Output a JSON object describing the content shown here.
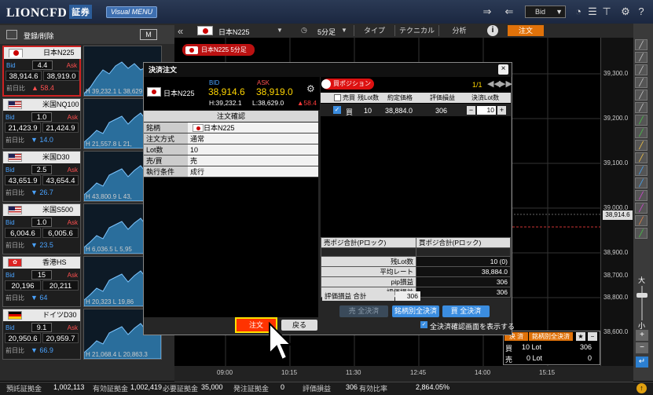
{
  "header": {
    "logo": "LIONCFD",
    "logo_badge": "証券",
    "visual_menu": "Visual MENU",
    "rate_select": "Bid"
  },
  "left": {
    "register_label": "登録/削除",
    "m_label": "M",
    "instruments": [
      {
        "name": "日本N225",
        "bid_label": "Bid",
        "ask_label": "Ask",
        "spread": "4.4",
        "bid": "38,914.6",
        "ask": "38,919.0",
        "prev_label": "前日比",
        "change": "▲ 58.4",
        "hl": "H 39,232.1  L 38,629",
        "flag": "jp",
        "dir": "up"
      },
      {
        "name": "米国NQ100",
        "bid_label": "Bid",
        "ask_label": "Ask",
        "spread": "1.0",
        "bid": "21,423.9",
        "ask": "21,424.9",
        "prev_label": "前日比",
        "change": "▼ 14.0",
        "hl": "H 21,557.8  L 21,",
        "flag": "us",
        "dir": "down"
      },
      {
        "name": "米国D30",
        "bid_label": "Bid",
        "ask_label": "Ask",
        "spread": "2.5",
        "bid": "43,651.9",
        "ask": "43,654.4",
        "prev_label": "前日比",
        "change": "▼ 26.7",
        "hl": "H 43,800.9  L 43,",
        "flag": "us",
        "dir": "down"
      },
      {
        "name": "米国S500",
        "bid_label": "Bid",
        "ask_label": "Ask",
        "spread": "1.0",
        "bid": "6,004.6",
        "ask": "6,005.6",
        "prev_label": "前日比",
        "change": "▼ 23.5",
        "hl": "H 6,036.5  L 5,95",
        "flag": "us",
        "dir": "down"
      },
      {
        "name": "香港HS",
        "bid_label": "Bid",
        "ask_label": "Ask",
        "spread": "15",
        "bid": "20,196",
        "ask": "20,211",
        "prev_label": "前日比",
        "change": "▼ 64",
        "hl": "H 20,323  L 19,86",
        "flag": "hk",
        "dir": "down"
      },
      {
        "name": "ドイツD30",
        "bid_label": "Bid",
        "ask_label": "Ask",
        "spread": "9.1",
        "bid": "20,950.6",
        "ask": "20,959.7",
        "prev_label": "前日比",
        "change": "▼ 66.9",
        "hl": "H 21,068.4  L 20,863.3",
        "flag": "de",
        "dir": "down"
      }
    ]
  },
  "chart": {
    "symbol": "日本N225",
    "timeframe": "5分足",
    "tabs": [
      "タイプ",
      "テクニカル",
      "分析",
      "注文"
    ],
    "badge": "日本N225 5分足",
    "y_ticks": [
      "39,300.0",
      "39,200.0",
      "39,100.0",
      "39,000.0",
      "38,900.0",
      "38,800.0",
      "38,700.0",
      "38,600.0"
    ],
    "current": "38,914.6",
    "x_ticks": [
      "09:00",
      "10:15",
      "11:30",
      "12:45",
      "14:00",
      "15:15"
    ],
    "zoom_big": "大",
    "zoom_small": "小",
    "page_num": "4"
  },
  "dialog": {
    "title": "決済注文",
    "symbol": "日本N225",
    "bid_label": "BID",
    "ask_label": "ASK",
    "bid": "38,914.6",
    "ask": "38,919.0",
    "high": "H:39,232.1",
    "low": "L:38,629.0",
    "change": "▲58.4",
    "confirm_title": "注文確認",
    "confirm_rows": [
      {
        "k": "銘柄",
        "v": "日本N225"
      },
      {
        "k": "注文方式",
        "v": "通常"
      },
      {
        "k": "Lot数",
        "v": "10"
      },
      {
        "k": "売/買",
        "v": "売"
      },
      {
        "k": "執行条件",
        "v": "成行"
      }
    ],
    "order_btn": "注文",
    "back_btn": "戻る",
    "pos_badge": "買ポジション",
    "pos_page": "1/1",
    "pos_headers": [
      "売買",
      "残Lot数",
      "約定価格",
      "評価損益",
      "決済Lot数"
    ],
    "pos_row": {
      "side": "買",
      "lot": "10",
      "price": "38,884.0",
      "pl": "306",
      "close_lot": "10"
    },
    "sum_head_left": "売ポジ合計(Pロック)",
    "sum_head_right": "買ポジ合計(Pロック)",
    "sum_rows": [
      {
        "k": "残Lot数",
        "v": "10 (0)"
      },
      {
        "k": "平均レート",
        "v": "38,884.0"
      },
      {
        "k": "pip損益",
        "v": "306"
      },
      {
        "k": "評価損益",
        "v": "306"
      }
    ],
    "total_label": "評価損益 合計",
    "total_value": "306",
    "btn_sell_all": "売 全決済",
    "btn_by_symbol": "銘柄別全決済",
    "btn_buy_all": "買 全決済",
    "checkbox_label": "全決済確認画面を表示する"
  },
  "pos_summary": {
    "title": "決 済",
    "by_symbol": "銘柄別全決済",
    "buy_label": "買",
    "buy_lot": "10 Lot",
    "buy_pl": "306",
    "sell_label": "売",
    "sell_lot": "0 Lot",
    "sell_pl": "0"
  },
  "footer": [
    {
      "k": "預託証拠金",
      "v": "1,002,113"
    },
    {
      "k": "有効証拠金",
      "v": "1,002,419"
    },
    {
      "k": "必要証拠金",
      "v": "35,000"
    },
    {
      "k": "発注証拠金",
      "v": "0"
    },
    {
      "k": "評価損益",
      "v": "306"
    },
    {
      "k": "有効比率",
      "v": "2,864.05%"
    }
  ]
}
